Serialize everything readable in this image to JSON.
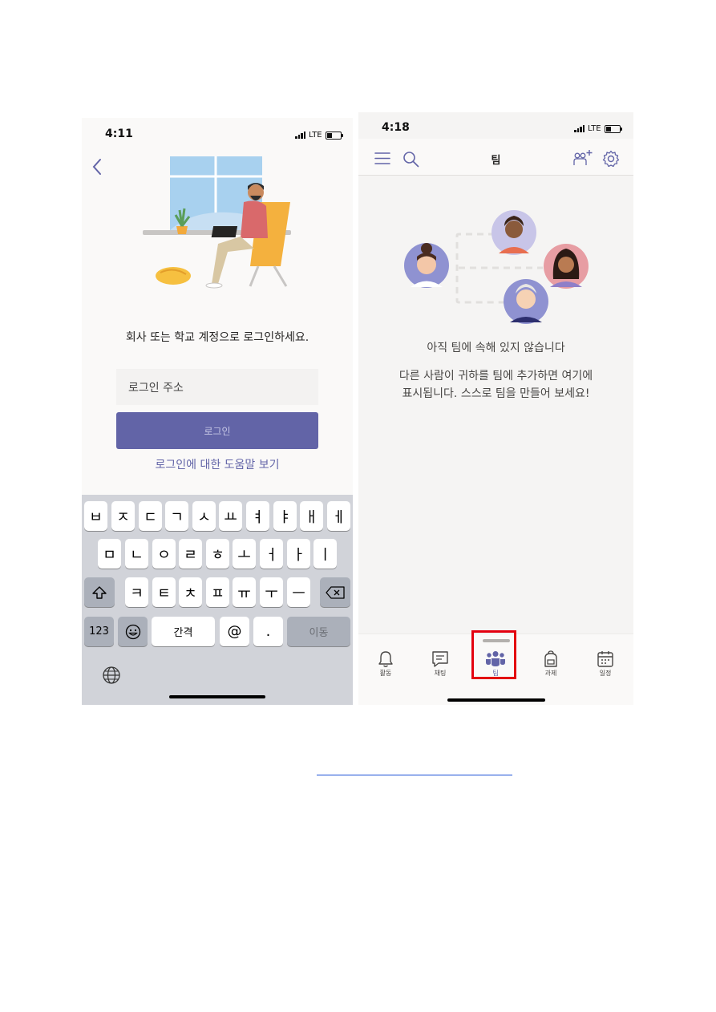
{
  "login_screen": {
    "status_time": "4:11",
    "status_network": "LTE",
    "prompt": "회사 또는 학교 계정으로 로그인하세요.",
    "input_placeholder": "로그인 주소",
    "login_button": "로그인",
    "help_link": "로그인에 대한 도움말 보기",
    "keyboard": {
      "row1": [
        "ㅂ",
        "ㅈ",
        "ㄷ",
        "ㄱ",
        "ㅅ",
        "ㅛ",
        "ㅕ",
        "ㅑ",
        "ㅐ",
        "ㅔ"
      ],
      "row2": [
        "ㅁ",
        "ㄴ",
        "ㅇ",
        "ㄹ",
        "ㅎ",
        "ㅗ",
        "ㅓ",
        "ㅏ",
        "ㅣ"
      ],
      "row3": [
        "ㅋ",
        "ㅌ",
        "ㅊ",
        "ㅍ",
        "ㅠ",
        "ㅜ",
        "ㅡ"
      ],
      "numbers_key": "123",
      "space_key": "간격",
      "at_key": "@",
      "period_key": ".",
      "return_key": "이동",
      "shift_icon": "shift-icon",
      "backspace_icon": "backspace-icon",
      "emoji_icon": "emoji-icon",
      "globe_icon": "globe-icon"
    },
    "accent_color": "#6264a7"
  },
  "teams_screen": {
    "status_time": "4:18",
    "status_network": "LTE",
    "title": "팀",
    "empty_title": "아직 팀에 속해 있지 않습니다",
    "empty_desc_line1": "다른 사람이 귀하를 팀에 추가하면 여기에",
    "empty_desc_line2": "표시됩니다. 스스로 팀을 만들어 보세요!",
    "tabs": [
      {
        "label": "활동",
        "icon": "bell-icon"
      },
      {
        "label": "채팅",
        "icon": "chat-icon"
      },
      {
        "label": "팀",
        "icon": "teams-icon",
        "active": true
      },
      {
        "label": "과제",
        "icon": "backpack-icon"
      },
      {
        "label": "일정",
        "icon": "calendar-icon"
      }
    ],
    "highlight_color": "#e3000f"
  }
}
